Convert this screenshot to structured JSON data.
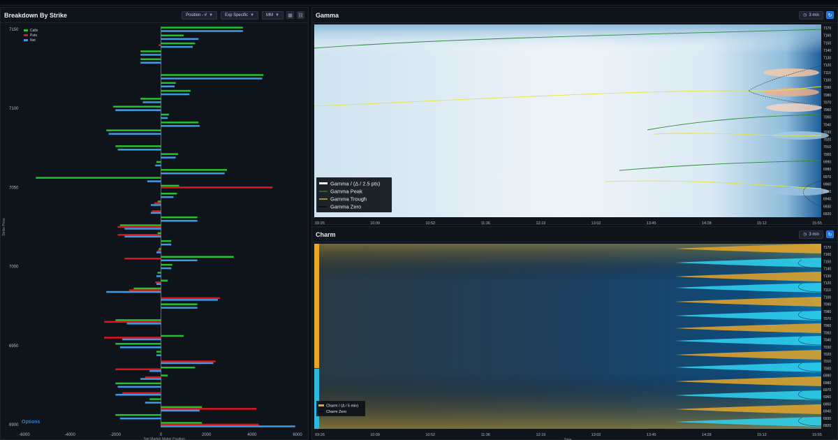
{
  "left_panel": {
    "title": "Breakdown By Strike",
    "controls": [
      "Position - #",
      "Exp Specific",
      "MM"
    ],
    "ylabel": "Strike Price",
    "xlabel": "Net Market Maker Position",
    "logo_text": "Options"
  },
  "gamma_panel": {
    "title": "Gamma",
    "interval": "3 min",
    "xlabel": "Time",
    "legend": [
      "Gamma / (Δ / 2.5 pts)",
      "Gamma Peak",
      "Gamma Trough",
      "Gamma Zero"
    ]
  },
  "charm_panel": {
    "title": "Charm",
    "interval": "3 min",
    "xlabel": "Time",
    "legend": [
      "Charm / (Δ / 5 min)",
      "Charm Zero"
    ]
  },
  "colors": {
    "calls": "#23c22e",
    "puts": "#e0161c",
    "net": "#3f9be6",
    "gamma_peak": "#2e8b3c",
    "gamma_trough": "#e6e23c",
    "charm_pos": "#e8a628",
    "charm_neg": "#2fd4f2"
  },
  "chart_data": [
    {
      "type": "bar",
      "orientation": "horizontal",
      "xlim": [
        -6000,
        6000
      ],
      "xticks": [
        "-6000",
        "-4000",
        "-2000",
        "0",
        "2000",
        "4000",
        "6000"
      ],
      "ytick_labels": [
        "7150",
        "7100",
        "7050",
        "7000",
        "6950",
        "6900"
      ],
      "legend": [
        "Calls",
        "Puts",
        "Net"
      ],
      "categories": [
        7150,
        7145,
        7140,
        7135,
        7130,
        7125,
        7120,
        7115,
        7110,
        7105,
        7100,
        7095,
        7090,
        7085,
        7080,
        7075,
        7070,
        7065,
        7060,
        7055,
        7050,
        7045,
        7040,
        7035,
        7030,
        7025,
        7020,
        7015,
        7010,
        7005,
        7000,
        6995,
        6990,
        6985,
        6980,
        6975,
        6970,
        6965,
        6960,
        6955,
        6950,
        6945,
        6940,
        6935,
        6930,
        6925,
        6920,
        6915,
        6910,
        6905,
        6900
      ],
      "series": [
        {
          "name": "Calls",
          "values": [
            3600,
            1000,
            1500,
            -900,
            -900,
            0,
            4500,
            650,
            1300,
            -900,
            -2100,
            350,
            1650,
            -2400,
            0,
            -2000,
            750,
            -200,
            2900,
            -5500,
            800,
            700,
            -150,
            0,
            1600,
            -1800,
            -150,
            450,
            -100,
            3200,
            500,
            -150,
            300,
            -1200,
            0,
            1600,
            0,
            -2000,
            0,
            1000,
            -2000,
            -200,
            0,
            1500,
            300,
            -2000,
            0,
            -500,
            1800,
            -2000,
            1800
          ],
          "values_puts": [
            0,
            0,
            -100,
            0,
            0,
            0,
            0,
            0,
            0,
            0,
            0,
            0,
            0,
            0,
            0,
            0,
            0,
            0,
            0,
            0,
            4900,
            0,
            -300,
            -400,
            0,
            -1900,
            -1900,
            0,
            -150,
            -1600,
            0,
            0,
            -250,
            -1400,
            2600,
            0,
            0,
            -2500,
            0,
            -2500,
            0,
            0,
            2400,
            -2000,
            -700,
            0,
            -1700,
            0,
            4200,
            0,
            4300
          ]
        },
        {
          "name": "Puts",
          "values": [
            0,
            0,
            -100,
            0,
            0,
            0,
            0,
            0,
            0,
            0,
            0,
            0,
            0,
            0,
            0,
            0,
            0,
            0,
            0,
            0,
            4900,
            0,
            -300,
            -400,
            0,
            -1900,
            -1900,
            0,
            -150,
            -1600,
            0,
            0,
            -250,
            -1400,
            2600,
            0,
            0,
            -2500,
            0,
            -2500,
            0,
            0,
            2400,
            -2000,
            -700,
            0,
            -1700,
            0,
            4200,
            0,
            4300
          ]
        },
        {
          "name": "Net",
          "values": [
            3600,
            1650,
            1400,
            -900,
            -900,
            0,
            4450,
            600,
            1250,
            -800,
            -2000,
            300,
            1700,
            -2300,
            0,
            -1900,
            650,
            -250,
            2800,
            -600,
            0,
            550,
            -450,
            -450,
            1600,
            -1600,
            -1600,
            450,
            -200,
            1600,
            450,
            -200,
            -200,
            -2400,
            2500,
            1600,
            0,
            -1500,
            0,
            -1700,
            -1800,
            -200,
            2300,
            -500,
            -900,
            -1900,
            -2000,
            -700,
            1700,
            -1800,
            5900
          ]
        }
      ]
    },
    {
      "type": "heatmap",
      "title": "Gamma",
      "xlabel": "Time",
      "x_ticks": [
        "09:26",
        "10:09",
        "10:52",
        "11:36",
        "12:19",
        "13:02",
        "13:45",
        "14:28",
        "15:12",
        "15:55"
      ],
      "y_ticks": [
        "7170",
        "7160",
        "7150",
        "7140",
        "7130",
        "7120",
        "7110",
        "7100",
        "7090",
        "7080",
        "7070",
        "7060",
        "7050",
        "7040",
        "7030",
        "7020",
        "7010",
        "7000",
        "6990",
        "6980",
        "6970",
        "6960",
        "6950",
        "6940",
        "6930",
        "6920"
      ],
      "legend": [
        "Gamma / (Δ / 2.5 pts)",
        "Gamma Peak",
        "Gamma Trough",
        "Gamma Zero"
      ]
    },
    {
      "type": "heatmap",
      "title": "Charm",
      "xlabel": "Time",
      "x_ticks": [
        "09:26",
        "10:09",
        "10:52",
        "11:36",
        "12:19",
        "13:02",
        "13:45",
        "14:28",
        "15:12",
        "15:55"
      ],
      "y_ticks": [
        "7170",
        "7160",
        "7150",
        "7140",
        "7130",
        "7120",
        "7110",
        "7100",
        "7090",
        "7080",
        "7070",
        "7060",
        "7050",
        "7040",
        "7030",
        "7020",
        "7010",
        "7000",
        "6990",
        "6980",
        "6970",
        "6960",
        "6950",
        "6940",
        "6930",
        "6920"
      ],
      "legend": [
        "Charm / (Δ / 5 min)",
        "Charm Zero"
      ]
    }
  ]
}
